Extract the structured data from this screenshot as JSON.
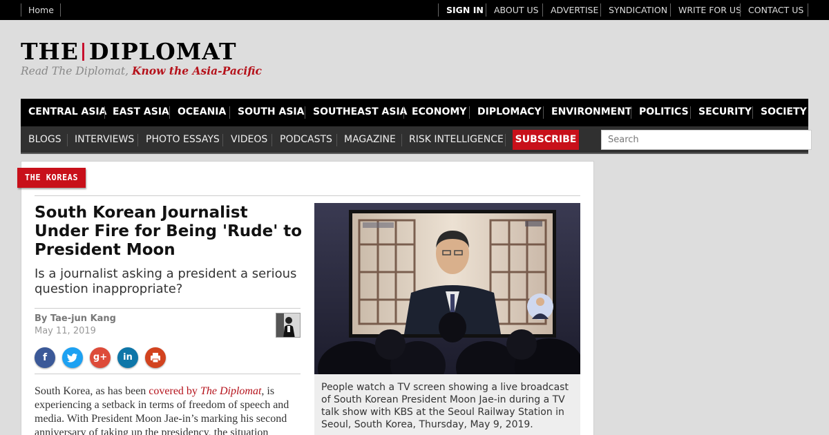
{
  "topbar": {
    "home": "Home",
    "links": [
      "SIGN IN",
      "ABOUT US",
      "ADVERTISE",
      "SYNDICATION",
      "WRITE FOR US",
      "CONTACT US"
    ]
  },
  "logo": {
    "word1": "THE",
    "word2": "DIPLOMAT",
    "tagline_plain": "Read The Diplomat, ",
    "tagline_bold": "Know the Asia-Pacific"
  },
  "nav_primary": [
    "CENTRAL ASIA",
    "EAST ASIA",
    "OCEANIA",
    "SOUTH ASIA",
    "SOUTHEAST ASIA",
    "ECONOMY",
    "DIPLOMACY",
    "ENVIRONMENT",
    "POLITICS",
    "SECURITY",
    "SOCIETY"
  ],
  "nav_secondary": [
    "BLOGS",
    "INTERVIEWS",
    "PHOTO ESSAYS",
    "VIDEOS",
    "PODCASTS",
    "MAGAZINE",
    "RISK INTELLIGENCE"
  ],
  "subscribe_label": "SUBSCRIBE",
  "search": {
    "placeholder": "Search"
  },
  "article": {
    "tag": "THE KOREAS",
    "headline": "South Korean Journalist Under Fire for Being 'Rude' to President Moon",
    "subhead": "Is a journalist asking a president a serious question inappropriate?",
    "byline": "By Tae-jun Kang",
    "date": "May 11, 2019",
    "social": [
      {
        "icon": "facebook-icon",
        "glyph": "f",
        "color": "#3b5998"
      },
      {
        "icon": "twitter-icon",
        "glyph": "t",
        "color": "#1da1f2"
      },
      {
        "icon": "google-plus-icon",
        "glyph": "g+",
        "color": "#dd4b39"
      },
      {
        "icon": "linkedin-icon",
        "glyph": "in",
        "color": "#0e76a8"
      },
      {
        "icon": "print-icon",
        "glyph": "⎙",
        "color": "#d2431f"
      }
    ],
    "body_prefix": "South Korea, as has been ",
    "body_link": "covered by ",
    "body_link_italic": "The Diplomat",
    "body_rest": ", is experiencing a setback in terms of freedom of speech and media. With President Moon Jae-in’s marking his second anniversary of taking up the presidency, the situation",
    "caption": "People watch a TV screen showing a live broadcast of South Korean President Moon Jae-in during a TV talk show with KBS at the Seoul Railway Station in Seoul, South Korea, Thursday, May 9, 2019."
  }
}
